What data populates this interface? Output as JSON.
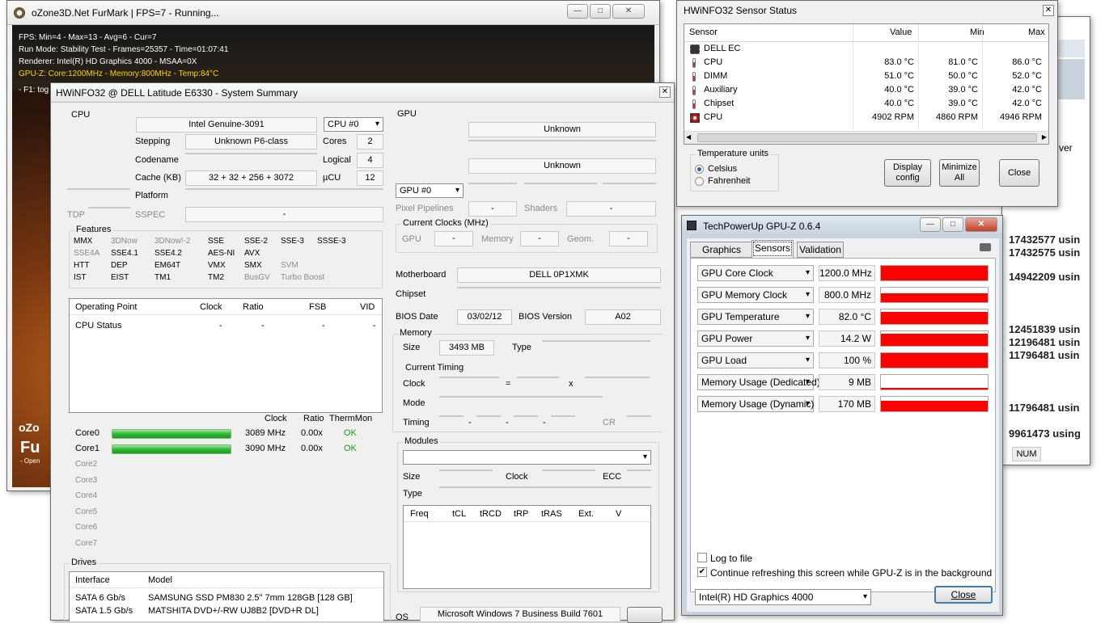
{
  "furmark": {
    "title": "oZone3D.Net FurMark | FPS=7 - Running...",
    "line1": "FPS: Min=4 - Max=13 - Avg=6 - Cur=7",
    "line2": "Run Mode: Stability Test - Frames=25357 - Time=01:07:41",
    "line3": "Renderer: Intel(R) HD Graphics 4000 - MSAA=0X",
    "line4": "GPU-Z: Core:1200MHz - Memory:800MHz - Temp:84°C",
    "line5": "- F1: tog",
    "logo1": "oZo",
    "logo2": "Fu",
    "logo3": "- Open"
  },
  "summary": {
    "title": "HWiNFO32 @ DELL Latitude E6330 - System Summary",
    "cpu": {
      "label": "CPU",
      "name": "Intel Genuine-3091",
      "select": "CPU #0",
      "stepping_label": "Stepping",
      "stepping": "Unknown P6-class",
      "cores_label": "Cores",
      "cores": "2",
      "codename_label": "Codename",
      "logical_label": "Logical",
      "logical": "4",
      "cache_label": "Cache (KB)",
      "cache": "32 + 32 + 256 + 3072",
      "ucu_label": "µCU",
      "ucu": "12",
      "platform_label": "Platform",
      "tdp_label": "TDP",
      "sspec_label": "SSPEC",
      "sspec": "-"
    },
    "features": {
      "label": "Features",
      "rows": [
        [
          "MMX",
          "3DNow",
          "3DNow!-2",
          "SSE",
          "SSE-2",
          "SSE-3",
          "SSSE-3"
        ],
        [
          "SSE4A",
          "SSE4.1",
          "SSE4.2",
          "AES-NI",
          "AVX"
        ],
        [
          "HTT",
          "DEP",
          "EM64T",
          "VMX",
          "SMX",
          "SVM"
        ],
        [
          "IST",
          "EIST",
          "TM1",
          "TM2",
          "BusGV",
          "Turbo Boost"
        ]
      ]
    },
    "op": {
      "headers": [
        "Operating Point",
        "Clock",
        "Ratio",
        "FSB",
        "VID"
      ],
      "row": [
        "CPU Status",
        "-",
        "-",
        "-",
        "-"
      ]
    },
    "cores": {
      "headers": [
        "Clock",
        "Ratio",
        "ThermMon"
      ],
      "rows": [
        {
          "name": "Core0",
          "clock": "3089 MHz",
          "ratio": "0.00x",
          "therm": "OK",
          "load": 1
        },
        {
          "name": "Core1",
          "clock": "3090 MHz",
          "ratio": "0.00x",
          "therm": "OK",
          "load": 1
        }
      ],
      "inactive": [
        "Core2",
        "Core3",
        "Core4",
        "Core5",
        "Core6",
        "Core7"
      ]
    },
    "drives": {
      "label": "Drives",
      "headers": [
        "Interface",
        "Model"
      ],
      "rows": [
        [
          "SATA 6 Gb/s",
          "SAMSUNG SSD PM830 2.5\" 7mm 128GB [128 GB]"
        ],
        [
          "SATA 1.5 Gb/s",
          "MATSHITA DVD+/-RW UJ8B2 [DVD+R DL]"
        ]
      ]
    },
    "gpu": {
      "label": "GPU",
      "name1": "Unknown",
      "name3": "Unknown",
      "select": "GPU #0",
      "pipelines_label": "Pixel Pipelines",
      "pipelines": "-",
      "shaders_label": "Shaders",
      "shaders": "-",
      "clocks_label": "Current Clocks (MHz)",
      "gpu_label": "GPU",
      "gpu_val": "-",
      "memory_label": "Memory",
      "memory_val": "-",
      "geom_label": "Geom.",
      "geom_val": "-"
    },
    "mb": {
      "label": "Motherboard",
      "value": "DELL 0P1XMK",
      "chipset_label": "Chipset",
      "bios_date_label": "BIOS Date",
      "bios_date": "03/02/12",
      "bios_ver_label": "BIOS Version",
      "bios_ver": "A02"
    },
    "memory": {
      "label": "Memory",
      "size_label": "Size",
      "size": "3493 MB",
      "type_label": "Type",
      "timing_label": "Current Timing",
      "clock_label": "Clock",
      "eq": "=",
      "x": "x",
      "mode_label": "Mode",
      "timing_row_label": "Timing",
      "dash": "-",
      "cr_label": "CR"
    },
    "modules": {
      "label": "Modules",
      "size_label": "Size",
      "clock_label": "Clock",
      "ecc_label": "ECC",
      "type_label": "Type",
      "headers": [
        "Freq",
        "tCL",
        "tRCD",
        "tRP",
        "tRAS",
        "Ext.",
        "V"
      ]
    },
    "os": {
      "label": "OS",
      "value": "Microsoft Windows 7 Business Build 7601"
    }
  },
  "sensor": {
    "title": "HWiNFO32 Sensor Status",
    "headers": [
      "Sensor",
      "Value",
      "Min",
      "Max"
    ],
    "rows": [
      {
        "name": "DELL EC",
        "value": "",
        "min": "",
        "max": "",
        "icon": "chip"
      },
      {
        "name": "CPU",
        "value": "83.0 °C",
        "min": "81.0 °C",
        "max": "86.0 °C",
        "icon": "therm"
      },
      {
        "name": "DIMM",
        "value": "51.0 °C",
        "min": "50.0 °C",
        "max": "52.0 °C",
        "icon": "therm"
      },
      {
        "name": "Auxiliary",
        "value": "40.0 °C",
        "min": "39.0 °C",
        "max": "42.0 °C",
        "icon": "therm"
      },
      {
        "name": "Chipset",
        "value": "40.0 °C",
        "min": "39.0 °C",
        "max": "42.0 °C",
        "icon": "therm"
      },
      {
        "name": "CPU",
        "value": "4902 RPM",
        "min": "4860 RPM",
        "max": "4946 RPM",
        "icon": "fan"
      }
    ],
    "units_label": "Temperature units",
    "celsius": "Celsius",
    "fahrenheit": "Fahrenheit",
    "display_btn": "Display config",
    "minimize_btn": "Minimize All",
    "close_btn": "Close"
  },
  "gpuz": {
    "title": "TechPowerUp GPU-Z 0.6.4",
    "tabs": [
      "Graphics Card",
      "Sensors",
      "Validation"
    ],
    "sensors": [
      {
        "name": "GPU Core Clock",
        "value": "1200.0 MHz",
        "fill": 1
      },
      {
        "name": "GPU Memory Clock",
        "value": "800.0 MHz",
        "fill": 0.6
      },
      {
        "name": "GPU Temperature",
        "value": "82.0 °C",
        "fill": 0.85
      },
      {
        "name": "GPU Power",
        "value": "14.2 W",
        "fill": 0.85
      },
      {
        "name": "GPU Load",
        "value": "100 %",
        "fill": 1
      },
      {
        "name": "Memory Usage (Dedicated)",
        "value": "9 MB",
        "fill": 0.1
      },
      {
        "name": "Memory Usage (Dynamic)",
        "value": "170 MB",
        "fill": 0.7
      }
    ],
    "log_label": "Log to file",
    "continue_label": "Continue refreshing this screen while GPU-Z is in the background",
    "device": "Intel(R) HD Graphics 4000",
    "close_btn": "Close"
  },
  "bg": {
    "lines": [
      "n ver",
      "17432577 usin",
      "17432575 usin",
      "14942209 usin",
      "12451839 usin",
      "12196481 usin",
      "11796481 usin",
      "11796481 usin",
      "9961473 using"
    ],
    "status": "NUM"
  },
  "colors": {
    "red": "#ff0000",
    "ok_green": "#1a9a1a",
    "bar_green": "#2eb82e"
  }
}
